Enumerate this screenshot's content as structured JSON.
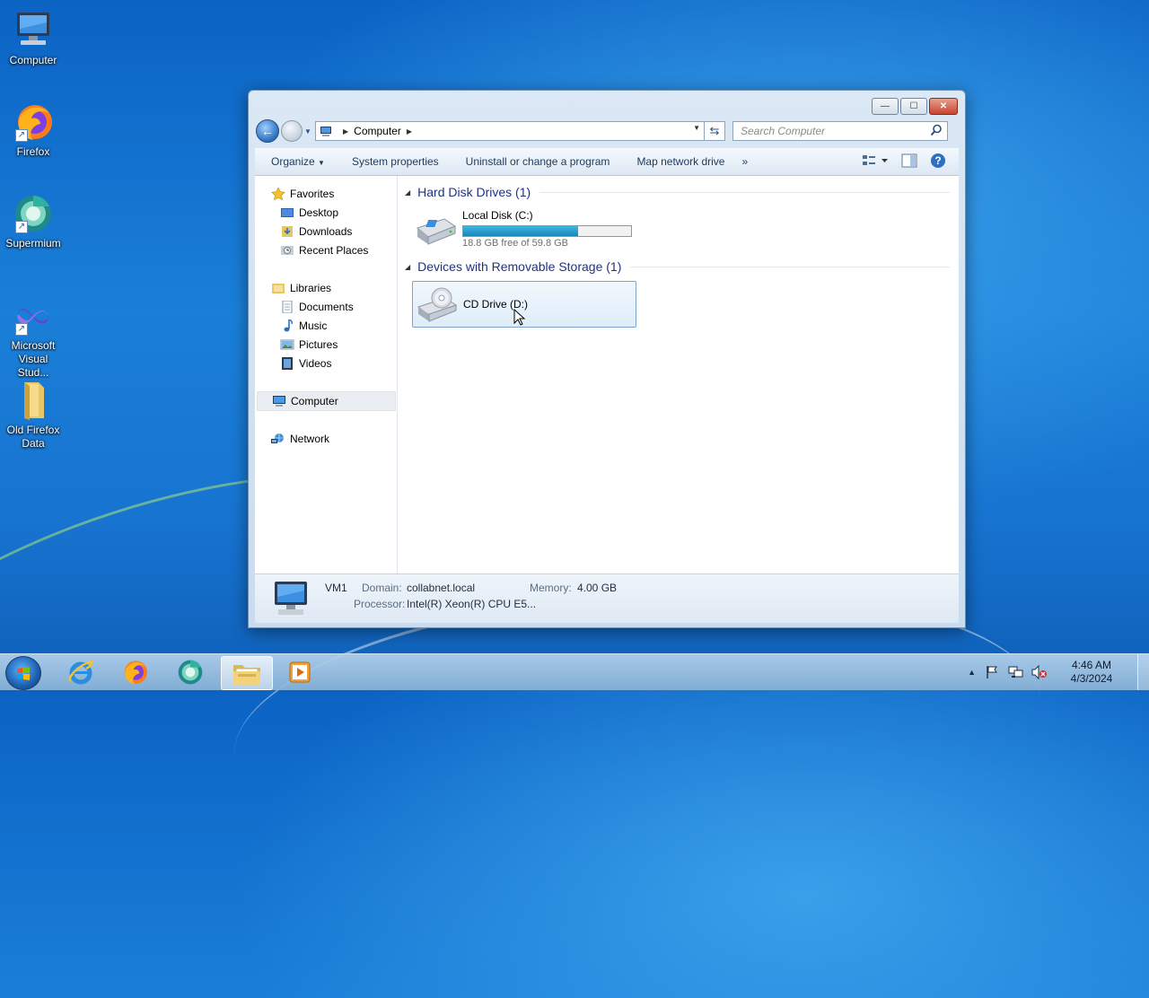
{
  "desktop": {
    "icons": [
      {
        "label": "Computer"
      },
      {
        "label": "Firefox"
      },
      {
        "label": "Supermium"
      },
      {
        "label": "Microsoft Visual Stud..."
      },
      {
        "label": "Old Firefox Data"
      }
    ]
  },
  "window": {
    "controls": {
      "minimize": "—",
      "maximize": "☐",
      "close": "✕"
    },
    "address": {
      "crumb": "Computer"
    },
    "search": {
      "placeholder": "Search Computer"
    },
    "toolbar": {
      "organize": "Organize",
      "system_properties": "System properties",
      "uninstall": "Uninstall or change a program",
      "map_drive": "Map network drive",
      "more": "»"
    },
    "nav": {
      "favorites": "Favorites",
      "desktop": "Desktop",
      "downloads": "Downloads",
      "recent": "Recent Places",
      "libraries": "Libraries",
      "documents": "Documents",
      "music": "Music",
      "pictures": "Pictures",
      "videos": "Videos",
      "computer": "Computer",
      "network": "Network"
    },
    "content": {
      "group_hdd": "Hard Disk Drives (1)",
      "group_removable": "Devices with Removable Storage (1)",
      "drive_c": {
        "name": "Local Disk (C:)",
        "free": "18.8 GB free of 59.8 GB",
        "used_fraction": 0.686
      },
      "drive_d": {
        "name": "CD Drive (D:)"
      }
    },
    "details": {
      "name": "VM1",
      "domain_label": "Domain:",
      "domain_value": "collabnet.local",
      "memory_label": "Memory:",
      "memory_value": "4.00 GB",
      "processor_label": "Processor:",
      "processor_value": "Intel(R) Xeon(R) CPU E5..."
    }
  },
  "taskbar": {
    "clock_time": "4:46 AM",
    "clock_date": "4/3/2024"
  }
}
